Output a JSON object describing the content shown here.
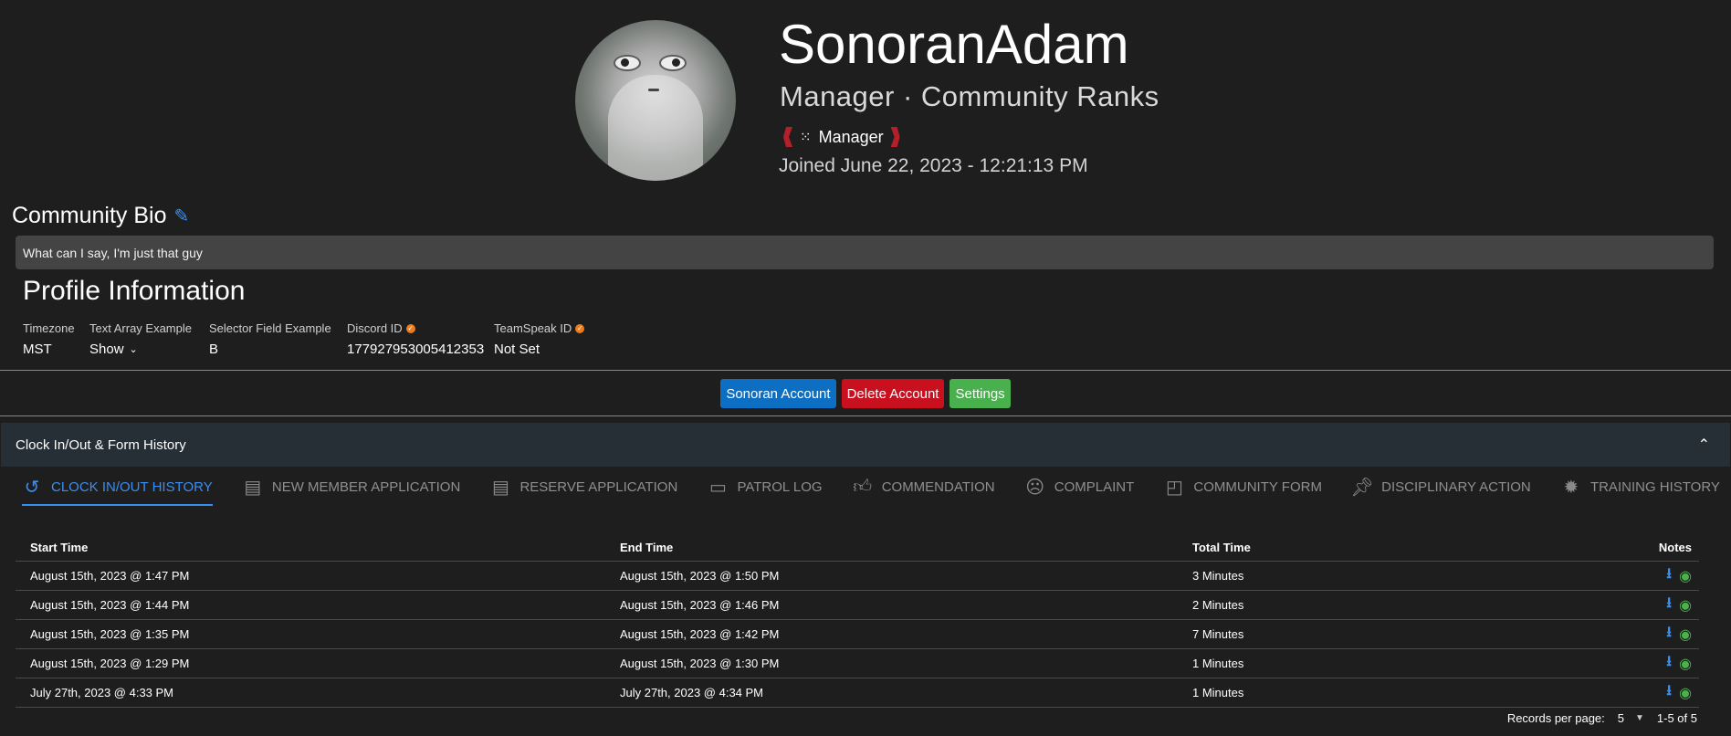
{
  "profile": {
    "username": "SonoranAdam",
    "subtitle": "Manager · Community Ranks",
    "rank": "Manager",
    "joined": "Joined June 22, 2023 - 12:21:13 PM"
  },
  "bio": {
    "title": "Community Bio",
    "text": "What can I say, I'm just that guy"
  },
  "profile_info": {
    "title": "Profile Information",
    "fields": [
      {
        "label": "Timezone",
        "value": "MST"
      },
      {
        "label": "Text Array Example",
        "value": "Show"
      },
      {
        "label": "Selector Field Example",
        "value": "B"
      },
      {
        "label": "Discord ID",
        "value": "177927953005412353"
      },
      {
        "label": "TeamSpeak ID",
        "value": "Not Set"
      }
    ]
  },
  "actions": {
    "sonoran_account": "Sonoran Account",
    "delete_account": "Delete Account",
    "settings": "Settings"
  },
  "panel": {
    "title": "Clock In/Out & Form History"
  },
  "tabs": [
    {
      "label": "CLOCK IN/OUT HISTORY",
      "icon": "history-icon"
    },
    {
      "label": "NEW MEMBER APPLICATION",
      "icon": "document-icon"
    },
    {
      "label": "RESERVE APPLICATION",
      "icon": "document-icon"
    },
    {
      "label": "PATROL LOG",
      "icon": "card-icon"
    },
    {
      "label": "COMMENDATION",
      "icon": "thumbs-up-icon"
    },
    {
      "label": "COMPLAINT",
      "icon": "frown-icon"
    },
    {
      "label": "COMMUNITY FORM",
      "icon": "note-icon"
    },
    {
      "label": "DISCIPLINARY ACTION",
      "icon": "pin-icon"
    },
    {
      "label": "TRAINING HISTORY",
      "icon": "badge-icon"
    }
  ],
  "table": {
    "headers": [
      "Start Time",
      "End Time",
      "Total Time",
      "Notes"
    ],
    "rows": [
      [
        "August 15th, 2023 @ 1:47 PM",
        "August 15th, 2023 @ 1:50 PM",
        "3 Minutes"
      ],
      [
        "August 15th, 2023 @ 1:44 PM",
        "August 15th, 2023 @ 1:46 PM",
        "2 Minutes"
      ],
      [
        "August 15th, 2023 @ 1:35 PM",
        "August 15th, 2023 @ 1:42 PM",
        "7 Minutes"
      ],
      [
        "August 15th, 2023 @ 1:29 PM",
        "August 15th, 2023 @ 1:30 PM",
        "1 Minutes"
      ],
      [
        "July 27th, 2023 @ 4:33 PM",
        "July 27th, 2023 @ 4:34 PM",
        "1 Minutes"
      ]
    ]
  },
  "pager": {
    "label": "Records per page:",
    "per_page": "5",
    "range": "1-5 of 5"
  },
  "colors": {
    "accent": "#3b8ef0",
    "background": "#1e1e1e",
    "danger": "#c8101f",
    "success": "#49b04e",
    "primary_button": "#0d6fc4"
  }
}
